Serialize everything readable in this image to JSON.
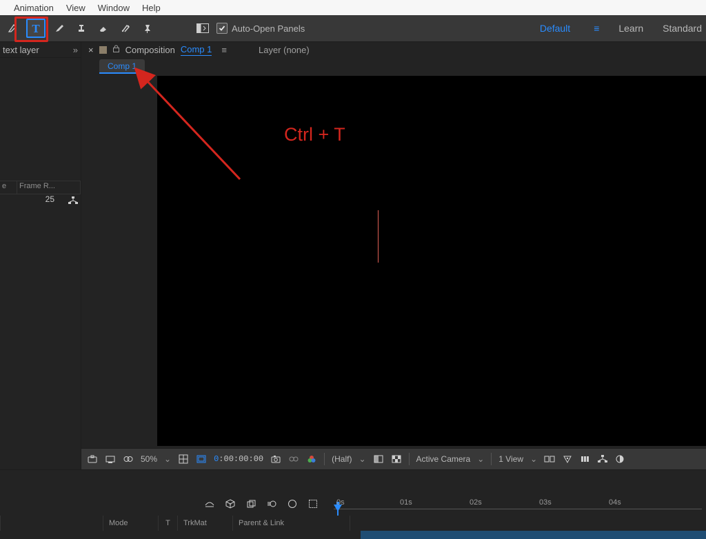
{
  "menubar": {
    "items": [
      "Animation",
      "View",
      "Window",
      "Help"
    ]
  },
  "toolbar": {
    "auto_open_label": "Auto-Open Panels",
    "workspaces": {
      "active": "Default",
      "items": [
        "Default",
        "Learn",
        "Standard"
      ]
    }
  },
  "left_panel": {
    "header_text": "text layer",
    "col1": "e",
    "col2": "Frame R...",
    "value": "25"
  },
  "comp_panel": {
    "comp_label": "Composition",
    "comp_name": "Comp 1",
    "layer_label": "Layer  (none)",
    "tab": "Comp 1"
  },
  "annotation": "Ctrl + T",
  "viewer": {
    "mag": "50%",
    "timecode": {
      "h": "0",
      "m": "00",
      "s": "00",
      "f": "00"
    },
    "res": "(Half)",
    "camera": "Active Camera",
    "view_count": "1 View"
  },
  "timeline": {
    "ticks": [
      "0s",
      "01s",
      "02s",
      "03s",
      "04s"
    ],
    "cols": [
      "Mode",
      "T",
      "TrkMat",
      "Parent & Link"
    ]
  },
  "timecode_sep": ":"
}
